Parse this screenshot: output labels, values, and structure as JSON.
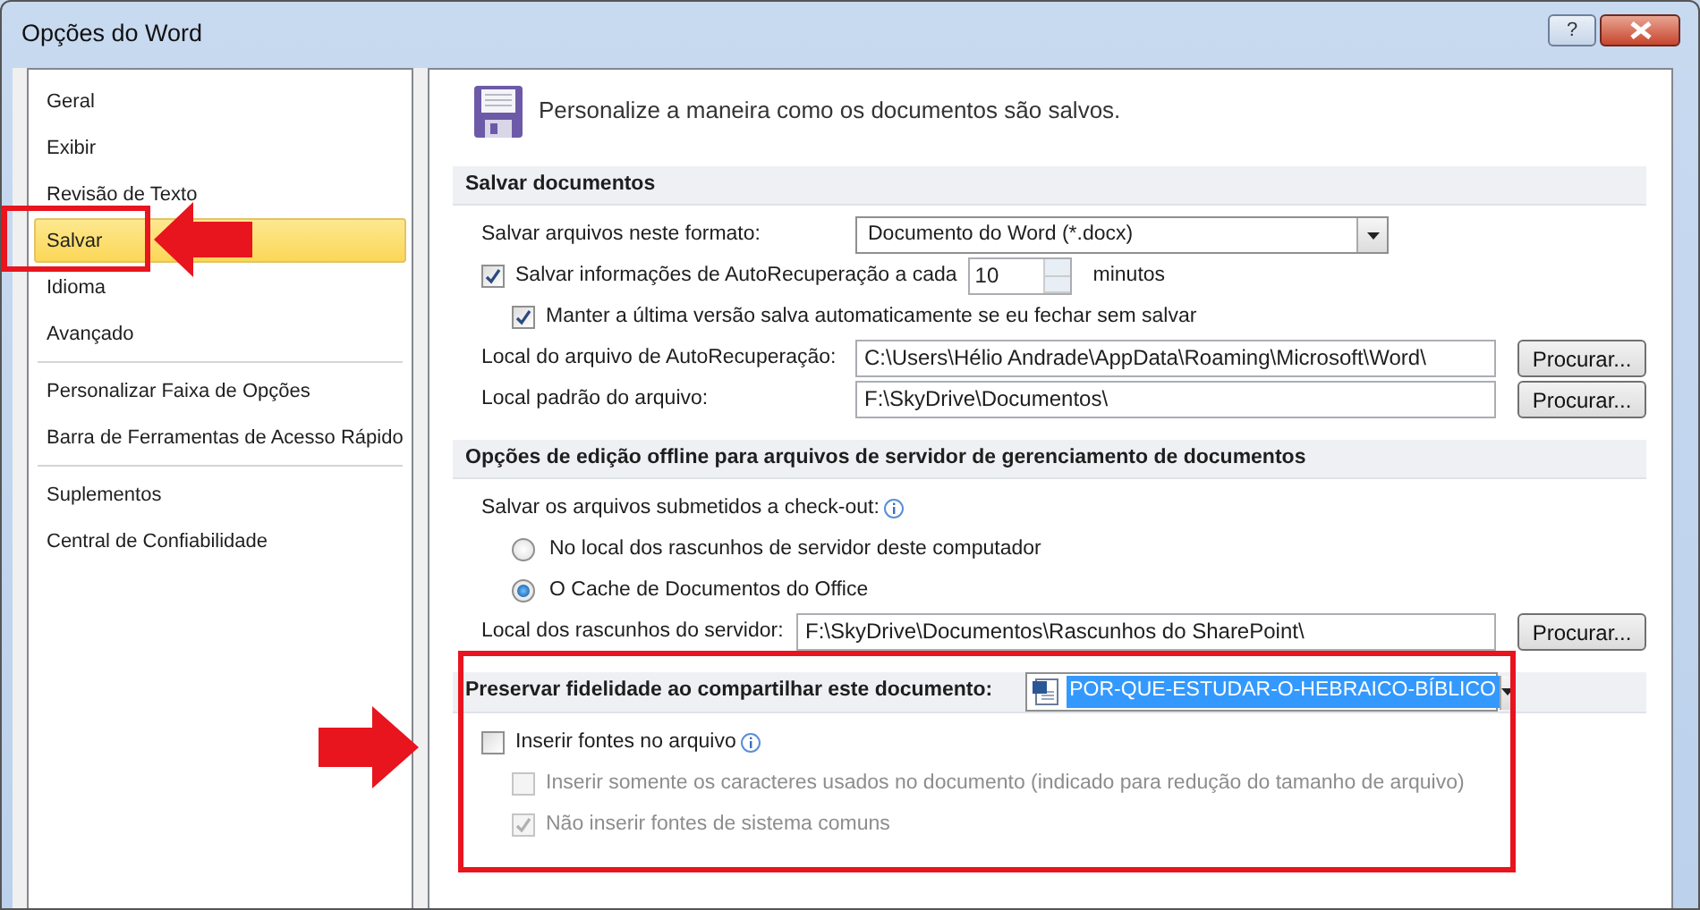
{
  "window": {
    "title": "Opções do Word",
    "help_button": "?"
  },
  "sidebar": {
    "groups": [
      [
        {
          "label": "Geral",
          "selected": false
        },
        {
          "label": "Exibir",
          "selected": false
        },
        {
          "label": "Revisão de Texto",
          "selected": false
        },
        {
          "label": "Salvar",
          "selected": true
        },
        {
          "label": "Idioma",
          "selected": false
        },
        {
          "label": "Avançado",
          "selected": false
        }
      ],
      [
        {
          "label": "Personalizar Faixa de Opções",
          "selected": false
        },
        {
          "label": "Barra de Ferramentas de Acesso Rápido",
          "selected": false
        }
      ],
      [
        {
          "label": "Suplementos",
          "selected": false
        },
        {
          "label": "Central de Confiabilidade",
          "selected": false
        }
      ]
    ]
  },
  "header": "Personalize a maneira como os documentos são salvos.",
  "sections": [
    {
      "title": "Salvar documentos",
      "rows": [
        {
          "kind": "select",
          "label": "Salvar arquivos neste formato:",
          "value": "Documento do Word (*.docx)"
        },
        {
          "kind": "checkbox",
          "label": "Salvar informações de AutoRecuperação a cada",
          "checked": true,
          "disabled": false,
          "spin_value": "10",
          "suffix": "minutos",
          "children": [
            {
              "kind": "checkbox",
              "label": "Manter a última versão salva automaticamente se eu fechar sem salvar",
              "checked": true,
              "disabled": false
            }
          ]
        },
        {
          "kind": "path",
          "label": "Local do arquivo de AutoRecuperação:",
          "value": "C:\\Users\\Hélio Andrade\\AppData\\Roaming\\Microsoft\\Word\\",
          "button": "Procurar..."
        },
        {
          "kind": "path",
          "label": "Local padrão do arquivo:",
          "value": "F:\\SkyDrive\\Documentos\\",
          "button": "Procurar..."
        }
      ]
    },
    {
      "title": "Opções de edição offline para arquivos de servidor de gerenciamento de documentos",
      "rows": [
        {
          "kind": "text",
          "label": "Salvar os arquivos submetidos a check-out:",
          "info": true,
          "children": [
            {
              "kind": "radio",
              "label": "No local dos rascunhos de servidor deste computador",
              "selected": false
            },
            {
              "kind": "radio",
              "label": "O Cache de Documentos do Office",
              "selected": true
            }
          ]
        },
        {
          "kind": "path",
          "label": "Local dos rascunhos do servidor:",
          "value": "F:\\SkyDrive\\Documentos\\Rascunhos do SharePoint\\",
          "button": "Procurar..."
        }
      ]
    },
    {
      "title": "Preservar fidelidade ao compartilhar este documento:",
      "title_select": {
        "value": "POR-QUE-ESTUDAR-O-HEBRAICO-BÍBLICO",
        "focused": true
      },
      "rows": [
        {
          "kind": "checkbox",
          "label": "Inserir fontes no arquivo",
          "checked": false,
          "disabled": false,
          "info": true,
          "children": [
            {
              "kind": "checkbox",
              "label": "Inserir somente os caracteres usados no documento (indicado para redução do tamanho de arquivo)",
              "checked": false,
              "disabled": true
            },
            {
              "kind": "checkbox",
              "label": "Não inserir fontes de sistema comuns",
              "checked": true,
              "disabled": true
            }
          ]
        }
      ]
    }
  ]
}
